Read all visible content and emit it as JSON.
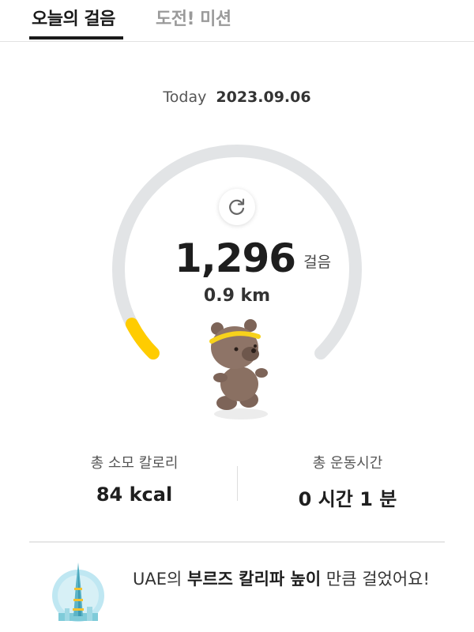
{
  "tabs": [
    {
      "label": "오늘의 걸음",
      "active": true
    },
    {
      "label": "도전! 미션",
      "active": false
    }
  ],
  "date": {
    "label": "Today",
    "value": "2023.09.06"
  },
  "steps": {
    "count": "1,296",
    "unit": "걸음",
    "distance": "0.9 km",
    "progress": 0.065
  },
  "colors": {
    "progress": "#ffcc00",
    "track": "#e2e4e6",
    "accent_text": "#1e1e1e"
  },
  "icons": {
    "refresh": "refresh-icon",
    "mascot": "bear-mascot-icon",
    "tower": "burj-khalifa-icon"
  },
  "stats": [
    {
      "label": "총 소모 칼로리",
      "value": "84 kcal"
    },
    {
      "label": "총 운동시간",
      "value": "0 시간 1 분"
    }
  ],
  "achievement": {
    "prefix": "UAE의 ",
    "highlight": "부르즈 칼리파 높이",
    "suffix": " 만큼 걸었어요!"
  }
}
